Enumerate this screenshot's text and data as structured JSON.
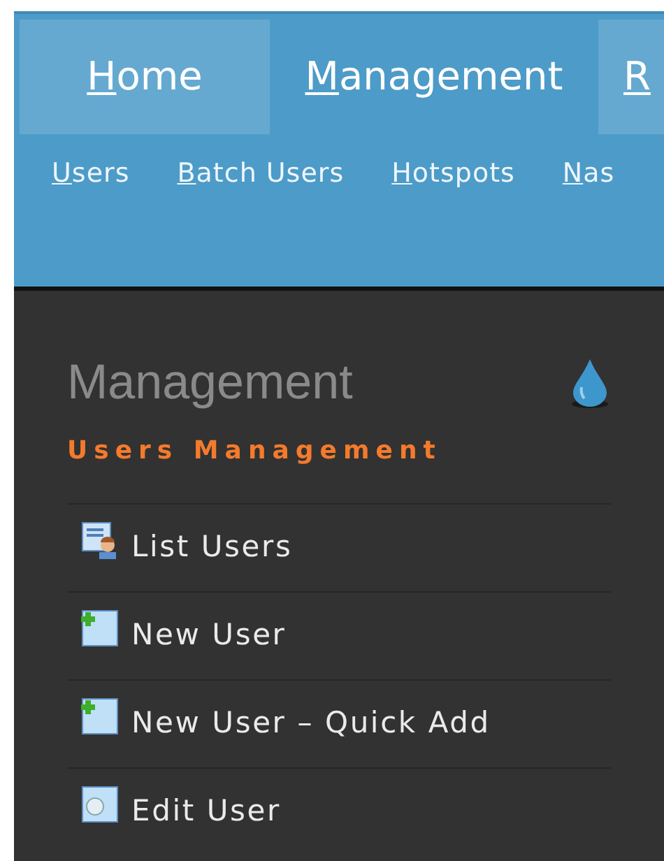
{
  "top_tabs": [
    {
      "label": "Home",
      "selected": false
    },
    {
      "label": "Management",
      "selected": true
    },
    {
      "label": "R",
      "selected": false
    }
  ],
  "sub_nav": [
    "Users",
    "Batch Users",
    "Hotspots",
    "Nas"
  ],
  "sidebar": {
    "title": "Management",
    "section": "Users Management",
    "items": [
      {
        "label": "List Users",
        "kind": "list"
      },
      {
        "label": "New User",
        "kind": "create"
      },
      {
        "label": "New User – Quick Add",
        "kind": "create"
      },
      {
        "label": "Edit User",
        "kind": "edit"
      }
    ]
  }
}
